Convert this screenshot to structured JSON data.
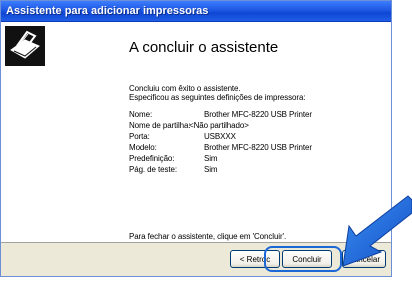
{
  "window": {
    "title": "Assistente para adicionar impressoras"
  },
  "wizard": {
    "heading": "A concluir o assistente",
    "intro_line1": "Concluiu com êxito o assistente.",
    "intro_line2": "Especificou as seguintes definições de impressora:",
    "settings": [
      {
        "label": "Nome:",
        "value": "Brother MFC-8220 USB Printer"
      },
      {
        "label": "Nome de partilha:",
        "value": "<Não partilhado>"
      },
      {
        "label": "Porta:",
        "value": "USBXXX"
      },
      {
        "label": "Modelo:",
        "value": "Brother MFC-8220 USB Printer"
      },
      {
        "label": "Predefinição:",
        "value": "Sim"
      },
      {
        "label": "Pág. de teste:",
        "value": "Sim"
      }
    ],
    "footer_note": "Para fechar o assistente, clique em 'Concluir'."
  },
  "buttons": {
    "back_label": "< Retroc",
    "finish_label": "Concluir",
    "cancel_label": "Cancelar"
  },
  "colors": {
    "titlebar": "#0f47d4",
    "button_bar": "#ece9d8",
    "annotation": "#1c67d6"
  },
  "icons": {
    "wizard_graphic": "printer-icon",
    "annotation_pointer": "arrow-icon"
  }
}
